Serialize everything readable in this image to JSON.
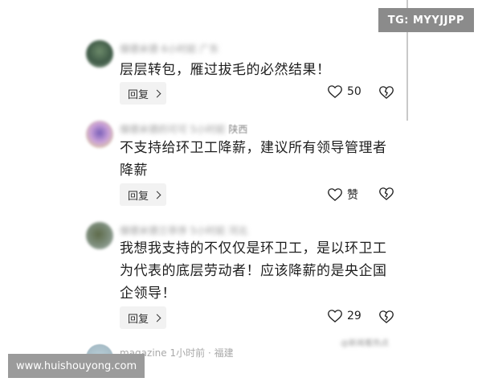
{
  "comments": [
    {
      "author": "傑德米德",
      "time": "6小时前",
      "location": "广东",
      "text_lines": [
        "层层转包，雁过拔毛的必然结果！"
      ],
      "reply_label": "回复",
      "like_label": "50"
    },
    {
      "author": "傑德米德的可可",
      "time": "5小时前",
      "location": "陕西",
      "text_lines": [
        "不支持给环卫工降薪，建议所有领导管理者",
        "降薪"
      ],
      "reply_label": "回复",
      "like_label": "赞"
    },
    {
      "author": "傑德米德兰亭序",
      "time": "5小时前",
      "location": "河北",
      "text_lines": [
        "我想我支持的不仅仅是环卫工，是以环卫工",
        "为代表的底层劳动者！应该降薪的是央企国",
        "企领导！"
      ],
      "reply_label": "回复",
      "like_label": "29"
    }
  ],
  "next_comment": {
    "author": "magazine",
    "time": "1小时前",
    "location": "福建"
  },
  "watermarks": {
    "tg": "TG: MYYJJPP",
    "site": "www.huishouyong.com",
    "source": "@新闻看热点"
  },
  "icons": [
    "heart-icon",
    "broken-heart-icon",
    "chevron-right-icon",
    "avatar"
  ],
  "colors": {
    "text": "#1e1e1e",
    "meta": "#8a8a8a",
    "reply_bg": "#f2f2f2",
    "badge_bg": "#8b8b8b"
  }
}
